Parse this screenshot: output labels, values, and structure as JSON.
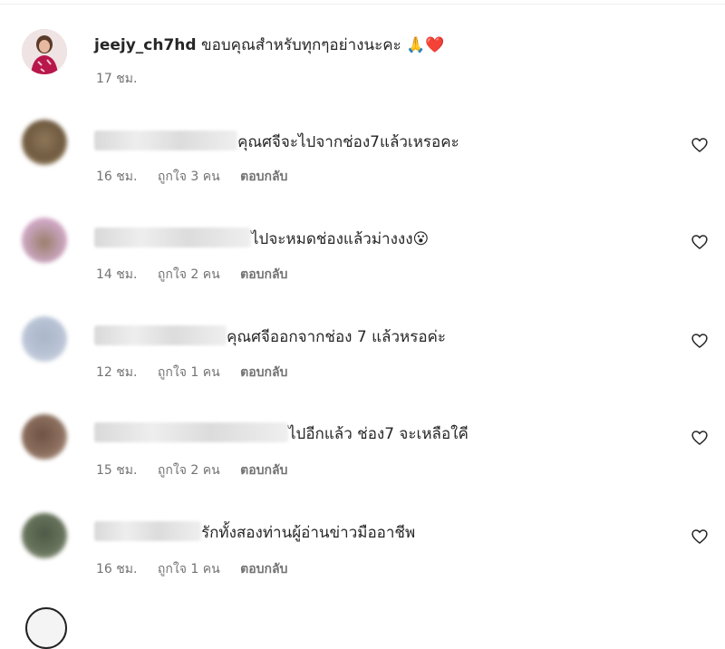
{
  "owner_comment": {
    "username": "jeejy_ch7hd",
    "text": "ขอบคุณสำหรับทุกๆอย่างนะคะ",
    "emoji_1": "🙏",
    "emoji_2": "❤️",
    "time": "17 ชม."
  },
  "comments": [
    {
      "text": "คุณศจีจะไปจากช่อง7แล้วเหรอคะ",
      "time": "16 ชม.",
      "likes": "ถูกใจ 3 คน",
      "reply": "ตอบกลับ"
    },
    {
      "text": "ไปจะหมดช่องแล้วม่างงง",
      "emoji": "😮",
      "time": "14 ชม.",
      "likes": "ถูกใจ 2 คน",
      "reply": "ตอบกลับ"
    },
    {
      "text": "คุณศจีออกจากช่อง 7 แล้วหรอค่ะ",
      "time": "12 ชม.",
      "likes": "ถูกใจ 1 คน",
      "reply": "ตอบกลับ"
    },
    {
      "text": "ไปอีกแล้ว ช่อง7 จะเหลือใคี",
      "time": "15 ชม.",
      "likes": "ถูกใจ 2 คน",
      "reply": "ตอบกลับ"
    },
    {
      "text": "รักทั้งสองท่านผู้อ่านข่าวมืออาชีพ",
      "time": "16 ชม.",
      "likes": "ถูกใจ 1 คน",
      "reply": "ตอบกลับ"
    }
  ],
  "icons": {
    "like": "heart-outline-icon"
  },
  "colors": {
    "text": "#262626",
    "secondary": "#737373",
    "heart_red": "#ed4956"
  }
}
